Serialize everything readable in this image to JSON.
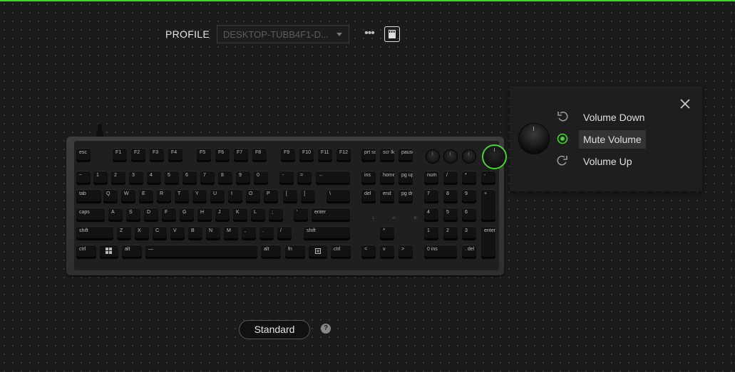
{
  "colors": {
    "accent": "#44d62c",
    "background": "#1b1b1b"
  },
  "profile": {
    "label": "PROFILE",
    "selected": "DESKTOP-TUBB4F1-D...",
    "more_icon": "more-horizontal-icon",
    "memory_icon": "onboard-memory-icon"
  },
  "keyboard": {
    "keys": [
      "esc",
      "F1",
      "F2",
      "F3",
      "F4",
      "F5",
      "F6",
      "F7",
      "F8",
      "F9",
      "F10",
      "F11",
      "F12",
      "prt sc",
      "scr lk",
      "pause",
      "num",
      "~",
      "1",
      "2",
      "3",
      "4",
      "5",
      "6",
      "7",
      "8",
      "9",
      "0",
      "-",
      "=",
      "←",
      "ins",
      "home",
      "pg up",
      "/",
      "*",
      "-",
      "tab",
      "Q",
      "W",
      "E",
      "R",
      "T",
      "Y",
      "U",
      "I",
      "O",
      "P",
      "[",
      "]",
      "\\",
      "del",
      "end",
      "pg dn",
      "7",
      "8",
      "9",
      "+",
      "caps",
      "A",
      "S",
      "D",
      "F",
      "G",
      "H",
      "J",
      "K",
      "L",
      ";",
      "'",
      "enter",
      "4",
      "5",
      "6",
      "shift",
      "Z",
      "X",
      "C",
      "V",
      "B",
      "N",
      "M",
      ",",
      ".",
      "/",
      "shift",
      "^",
      "1",
      "2",
      "3",
      "enter",
      "ctrl",
      "alt",
      "—",
      "alt",
      "fn",
      "ctrl",
      "<",
      "v",
      ">",
      "0 ins",
      ". del"
    ]
  },
  "popup": {
    "close_icon": "close-icon",
    "options": [
      {
        "label": "Volume Down",
        "icon": "rotate-ccw-icon"
      },
      {
        "label": "Mute Volume",
        "icon": "radio-selected-icon"
      },
      {
        "label": "Volume Up",
        "icon": "rotate-cw-icon"
      }
    ]
  },
  "footer": {
    "mode_label": "Standard",
    "help_icon": "help-icon",
    "help_text": "?"
  }
}
